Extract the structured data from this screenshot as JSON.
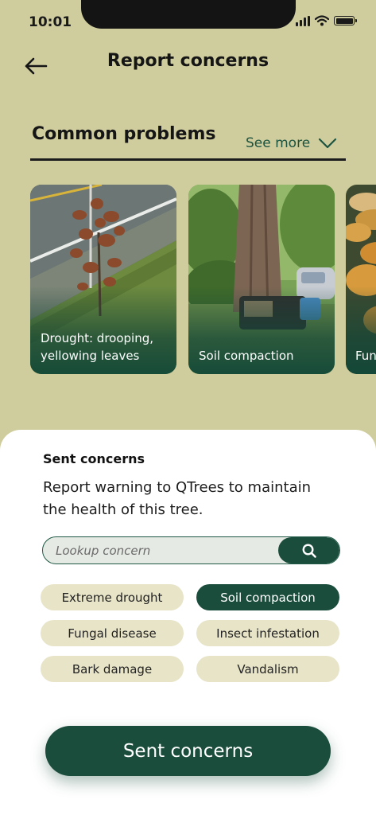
{
  "status_bar": {
    "time": "10:01"
  },
  "header": {
    "title": "Report concerns",
    "back_icon": "arrow-left-icon"
  },
  "common_problems": {
    "title": "Common problems",
    "see_more_label": "See more",
    "cards": [
      {
        "label": "Drought: drooping, yellowing leaves"
      },
      {
        "label": "Soil compaction"
      },
      {
        "label": "Fungal disease"
      }
    ]
  },
  "sheet": {
    "title": "Sent concerns",
    "description": "Report warning to QTrees to maintain the health of this tree.",
    "search": {
      "placeholder": "Lookup concern",
      "icon": "search-icon"
    },
    "chips": [
      {
        "label": "Extreme drought",
        "selected": false
      },
      {
        "label": "Soil compaction",
        "selected": true
      },
      {
        "label": "Fungal disease",
        "selected": false
      },
      {
        "label": "Insect infestation",
        "selected": false
      },
      {
        "label": "Bark damage",
        "selected": false
      },
      {
        "label": "Vandalism",
        "selected": false
      }
    ],
    "submit_label": "Sent concerns"
  },
  "colors": {
    "background": "#cfcd9e",
    "accent": "#1a4d3c",
    "chip": "#e8e4c8"
  }
}
